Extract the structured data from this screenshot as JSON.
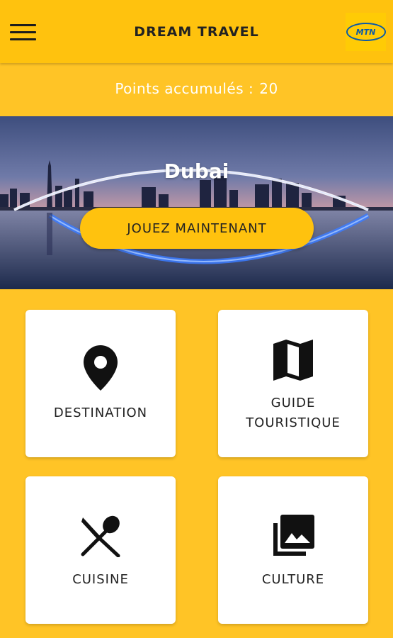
{
  "app": {
    "title": "DREAM TRAVEL",
    "logo_text": "MTN",
    "brand_color": "#FFC20E",
    "icons": {
      "menu": "hamburger-menu-icon"
    }
  },
  "points": {
    "label": "Points accumulés :",
    "value": "20"
  },
  "banner": {
    "city": "Dubai",
    "play_label": "JOUEZ MAINTENANT"
  },
  "cards": [
    {
      "label": "DESTINATION",
      "icon": "location-pin-icon"
    },
    {
      "label_line1": "GUIDE",
      "label_line2": "TOURISTIQUE",
      "icon": "map-icon"
    },
    {
      "label": "CUISINE",
      "icon": "utensils-icon"
    },
    {
      "label": "CULTURE",
      "icon": "photo-library-icon"
    }
  ]
}
